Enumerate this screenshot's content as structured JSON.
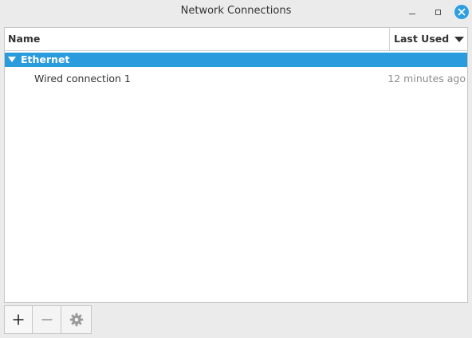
{
  "window": {
    "title": "Network Connections"
  },
  "columns": {
    "name": "Name",
    "last_used": "Last Used"
  },
  "groups": [
    {
      "label": "Ethernet",
      "connections": [
        {
          "name": "Wired connection 1",
          "last_used": "12 minutes ago"
        }
      ]
    }
  ],
  "toolbar": {
    "add_icon": "plus-icon",
    "remove_icon": "minus-icon",
    "settings_icon": "gear-icon"
  },
  "colors": {
    "accent": "#2a9bdd",
    "close_button": "#2f9ee0",
    "background": "#ebebeb",
    "muted_text": "#8c8c8c"
  }
}
